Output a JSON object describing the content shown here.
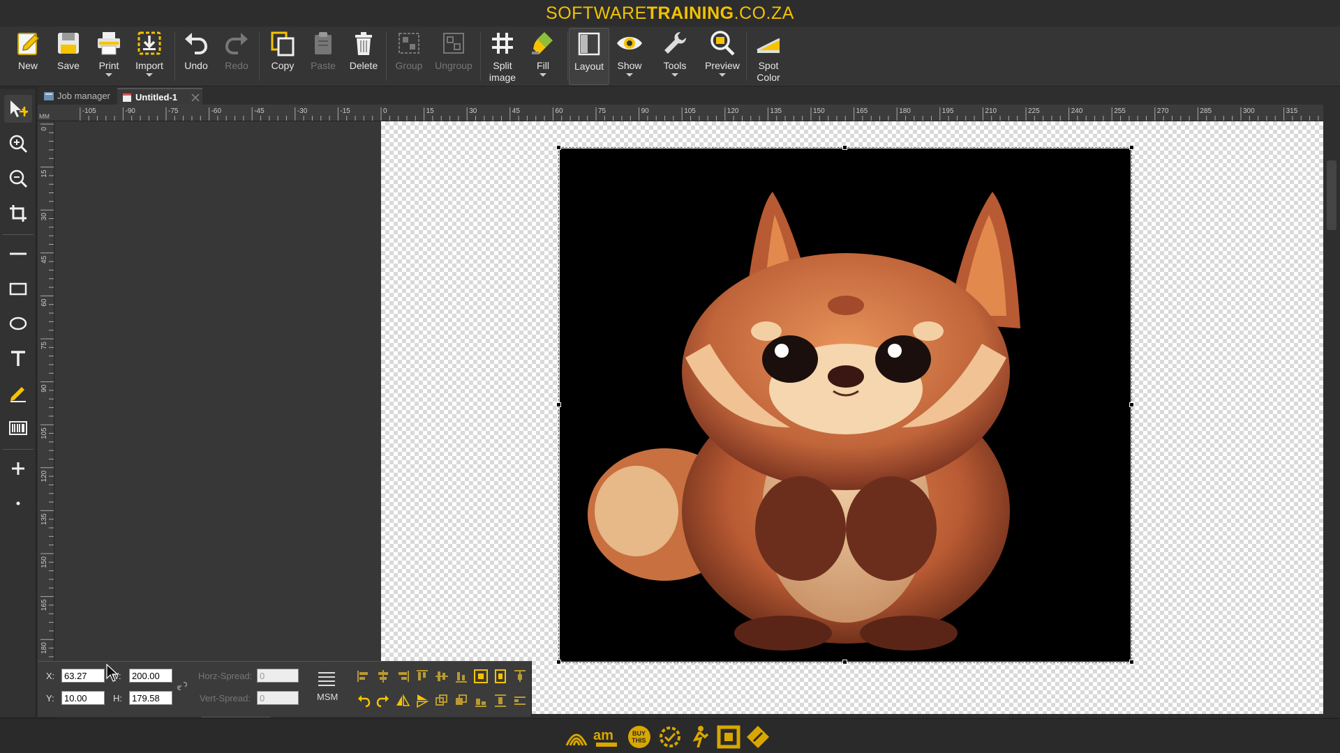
{
  "title": {
    "brand_prefix": "SOFTWARE",
    "brand_bold": "TRAINING",
    "brand_suffix": ".CO.ZA"
  },
  "toolbar": {
    "new": "New",
    "save": "Save",
    "print": "Print",
    "import": "Import",
    "undo": "Undo",
    "redo": "Redo",
    "copy": "Copy",
    "paste": "Paste",
    "delete": "Delete",
    "group": "Group",
    "ungroup": "Ungroup",
    "split_image_1": "Split",
    "split_image_2": "image",
    "fill": "Fill",
    "layout": "Layout",
    "show": "Show",
    "tools": "Tools",
    "preview": "Preview",
    "spot_color_1": "Spot",
    "spot_color_2": "Color"
  },
  "tabs": [
    {
      "label": "Job manager"
    },
    {
      "label": "Untitled-1"
    }
  ],
  "ruler": {
    "unit": "MM",
    "h_ticks": [
      "-105",
      "-90",
      "-75",
      "-60",
      "-45",
      "-30",
      "-15",
      "0",
      "15",
      "30",
      "45",
      "60",
      "75",
      "90",
      "105",
      "120",
      "135",
      "150",
      "165",
      "180",
      "195",
      "210",
      "225",
      "240",
      "255",
      "270",
      "285",
      "300",
      "315"
    ],
    "v_ticks": [
      "0",
      "15",
      "30",
      "45",
      "60",
      "75",
      "90",
      "105",
      "120",
      "135",
      "150",
      "165",
      "180"
    ]
  },
  "properties": {
    "x_label": "X:",
    "x_value": "63.27",
    "y_label": "Y:",
    "y_value": "10.00",
    "w_label": "W:",
    "w_value": "200.00",
    "h_label": "H:",
    "h_value": "179.58",
    "horz_spread_label": "Horz-Spread:",
    "horz_spread_value": "0",
    "vert_spread_label": "Vert-Spread:",
    "vert_spread_value": "0",
    "msm_label": "MSM"
  },
  "colors": {
    "brand": "#f2c200",
    "accent_yellow": "#f5c400",
    "background": "#2b2b2b"
  }
}
